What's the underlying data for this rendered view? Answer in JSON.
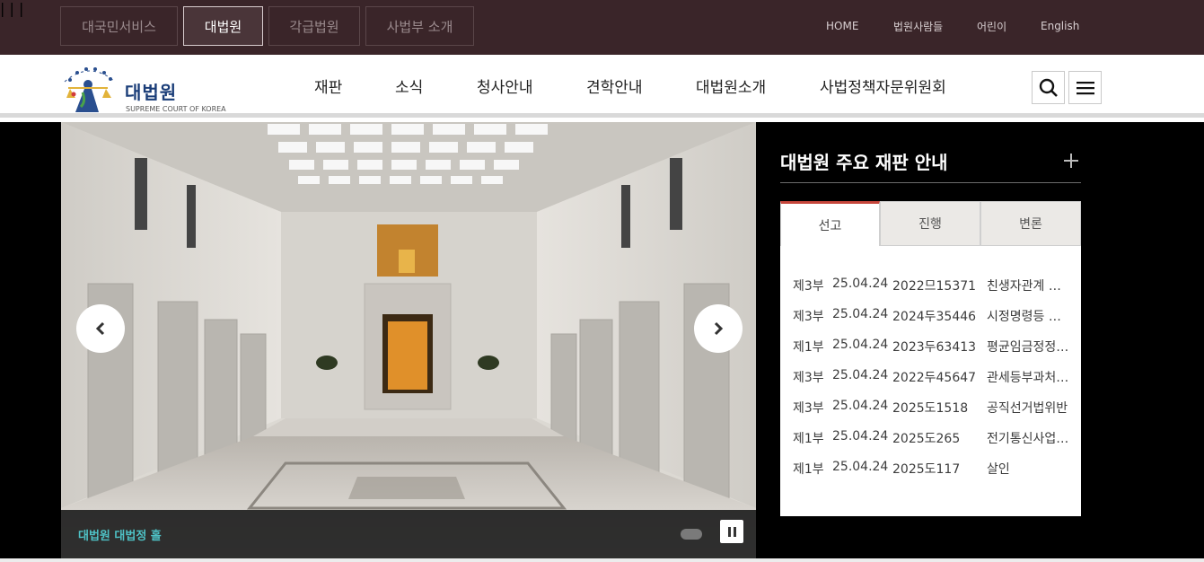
{
  "topbar": {
    "services": [
      "대국민서비스",
      "대법원",
      "각급법원",
      "사법부 소개"
    ],
    "active_service": "대법원",
    "util_links": [
      "HOME",
      "법원사람들",
      "어린이",
      "English"
    ]
  },
  "header": {
    "logo_title": "대법원",
    "logo_subtitle": "SUPREME COURT OF KOREA",
    "nav": [
      "재판",
      "소식",
      "청사안내",
      "견학안내",
      "대법원소개",
      "사법정책자문위원회"
    ]
  },
  "visual": {
    "caption": "대법원 대법정 홀"
  },
  "panel": {
    "title": "대법원 주요 재판 안내",
    "tabs": [
      "선고",
      "진행",
      "변론"
    ],
    "active_tab": "선고",
    "rows": [
      {
        "bench": "제3부",
        "date": "25.04.24",
        "case_no": "2022므15371",
        "case_name": "친생자관계 존…"
      },
      {
        "bench": "제3부",
        "date": "25.04.24",
        "case_no": "2024두35446",
        "case_name": "시정명령등 취소"
      },
      {
        "bench": "제1부",
        "date": "25.04.24",
        "case_no": "2023두63413",
        "case_name": "평균임금정정…"
      },
      {
        "bench": "제3부",
        "date": "25.04.24",
        "case_no": "2022두45647",
        "case_name": "관세등부과처…"
      },
      {
        "bench": "제3부",
        "date": "25.04.24",
        "case_no": "2025도1518",
        "case_name": "공직선거법위반"
      },
      {
        "bench": "제1부",
        "date": "25.04.24",
        "case_no": "2025도265",
        "case_name": "전기통신사업…"
      },
      {
        "bench": "제1부",
        "date": "25.04.24",
        "case_no": "2025도117",
        "case_name": "살인"
      }
    ]
  },
  "icons": {
    "search": "search-icon",
    "menu": "menu-icon",
    "prev": "chevron-left-icon",
    "next": "chevron-right-icon",
    "plus": "plus-icon",
    "pause": "pause-icon"
  },
  "colors": {
    "topbar_bg": "#3a2529",
    "brand_blue": "#1a3d78",
    "caption_teal": "#4ec2c6",
    "tab_accent": "#c6463b"
  }
}
